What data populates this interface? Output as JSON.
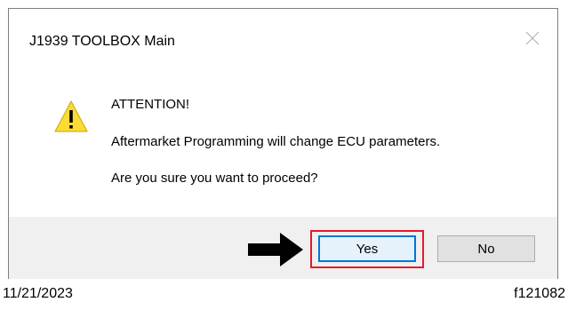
{
  "dialog": {
    "title": "J1939 TOOLBOX Main",
    "close_icon": "close-icon",
    "warning_icon": "warning-triangle-icon",
    "message_line1": "ATTENTION!",
    "message_line2": "Aftermarket Programming will change ECU parameters.",
    "message_line3": "Are you sure you want to proceed?",
    "yes_label": "Yes",
    "no_label": "No",
    "highlight_color": "#e8192c",
    "arrow_icon": "right-arrow-icon"
  },
  "caption": {
    "date": "11/21/2023",
    "figure_id": "f121082"
  }
}
